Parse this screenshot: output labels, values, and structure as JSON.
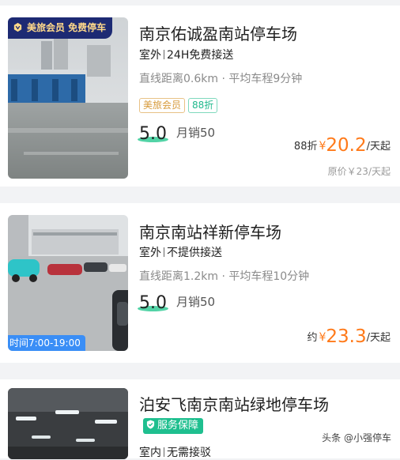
{
  "listings": [
    {
      "ribbon": "美旅会员 免费停车",
      "title": "南京佑诚盈南站停车场",
      "location": "室外",
      "shuttle": "24H免费接送",
      "distance": "直线距离0.6km · 平均车程9分钟",
      "tags": [
        "美旅会员",
        "88折"
      ],
      "rating": "5.0",
      "sales": "月销50",
      "discount": "88折",
      "currency": "¥",
      "price": "20.2",
      "unit": "/天起",
      "original": "原价￥23/天起"
    },
    {
      "hours": "时间7:00-19:00",
      "title": "南京南站祥新停车场",
      "location": "室外",
      "shuttle": "不提供接送",
      "distance": "直线距离1.2km · 平均车程10分钟",
      "rating": "5.0",
      "sales": "月销50",
      "prefix": "约",
      "currency": "¥",
      "price": "23.3",
      "unit": "/天起"
    },
    {
      "title": "泊安飞南京南站绿地停车场",
      "service": "服务保障",
      "location": "室内",
      "shuttle": "无需接驳"
    }
  ],
  "watermark": "头条 @小强停车",
  "colors": {
    "accent_orange": "#ff7a1a",
    "teal": "#1fbf8f",
    "navy_ribbon": "#1d2a73"
  }
}
